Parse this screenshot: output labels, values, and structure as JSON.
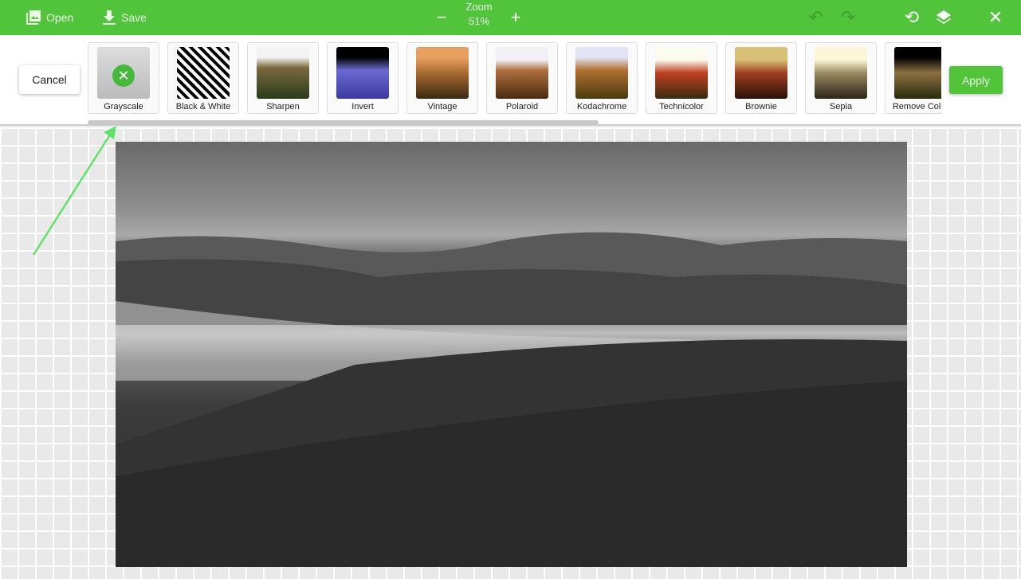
{
  "toolbar": {
    "open_label": "Open",
    "save_label": "Save",
    "zoom_label": "Zoom",
    "zoom_value": "51%",
    "accent": "#52c43c",
    "icons": [
      "image-icon",
      "download-icon",
      "minus-icon",
      "plus-icon",
      "undo-icon",
      "redo-icon",
      "history-icon",
      "layers-icon",
      "close-icon"
    ]
  },
  "filters": {
    "cancel_label": "Cancel",
    "apply_label": "Apply",
    "selected": "Grayscale",
    "items": [
      {
        "label": "Grayscale"
      },
      {
        "label": "Black & White"
      },
      {
        "label": "Sharpen"
      },
      {
        "label": "Invert"
      },
      {
        "label": "Vintage"
      },
      {
        "label": "Polaroid"
      },
      {
        "label": "Kodachrome"
      },
      {
        "label": "Technicolor"
      },
      {
        "label": "Brownie"
      },
      {
        "label": "Sepia"
      },
      {
        "label": "Remove Color"
      }
    ]
  }
}
